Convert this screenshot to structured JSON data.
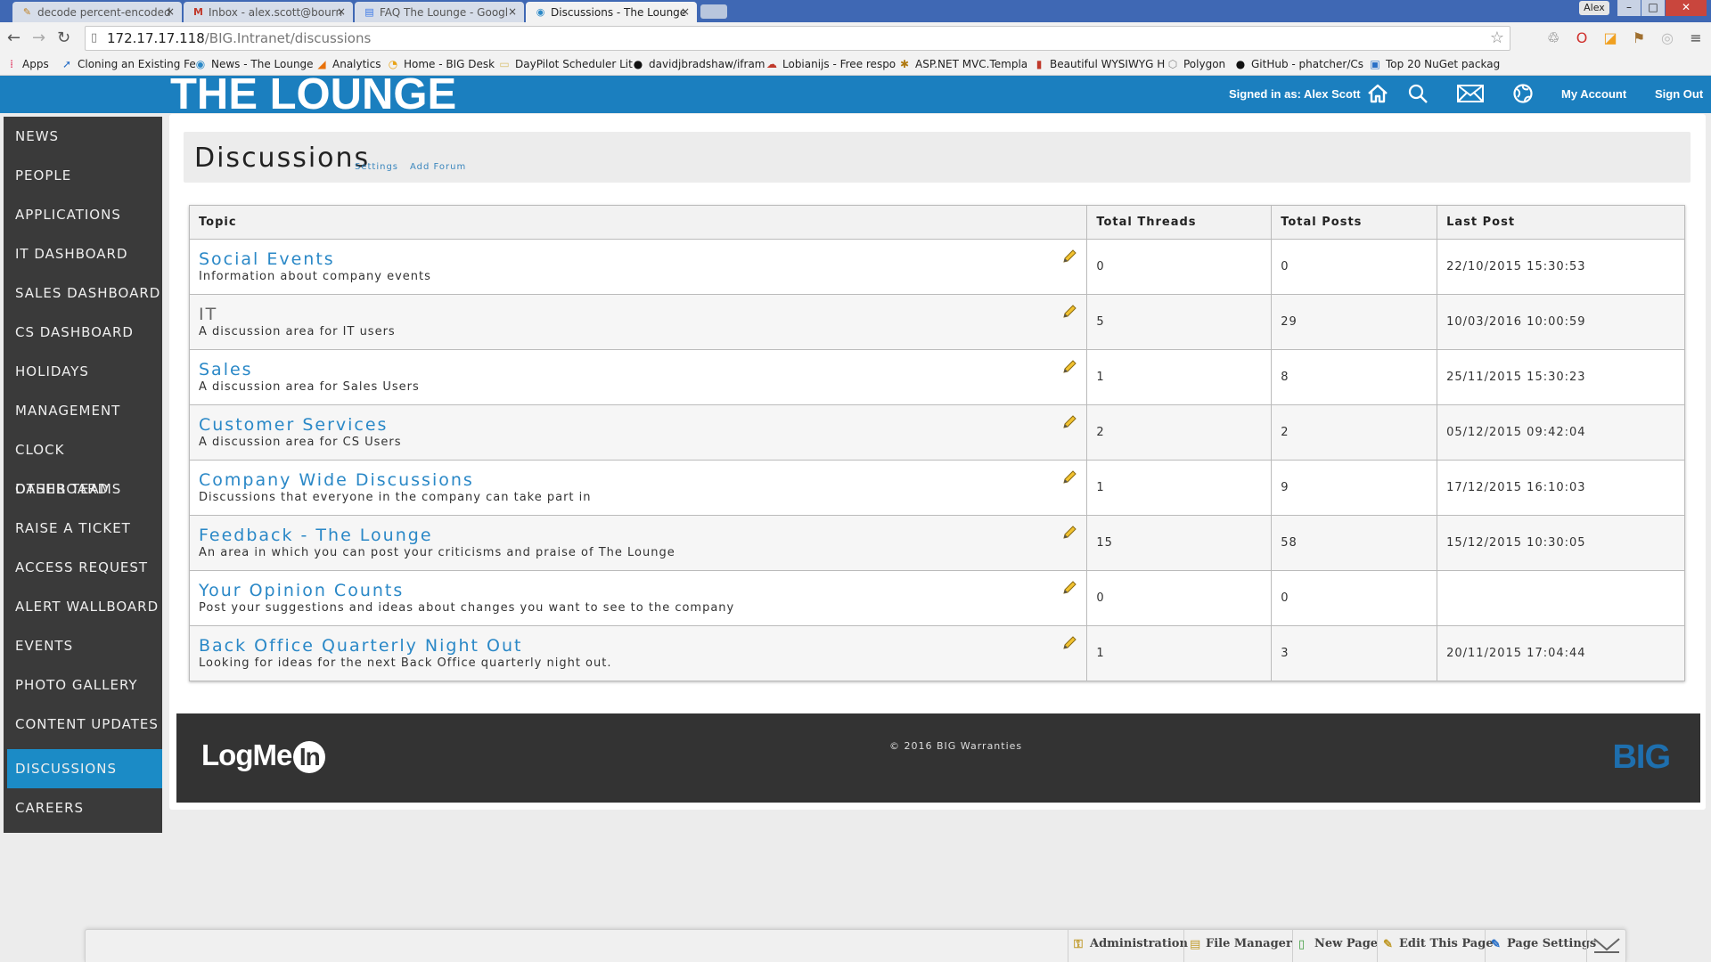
{
  "browser": {
    "tabs": [
      {
        "label": "decode percent-encoded",
        "icon": "tool-icon"
      },
      {
        "label": "Inbox - alex.scott@bourn",
        "icon": "gmail-icon"
      },
      {
        "label": "FAQ The Lounge - Googl",
        "icon": "docs-icon"
      },
      {
        "label": "Discussions - The Lounge",
        "icon": "lounge-icon",
        "active": true
      }
    ],
    "window_user": "Alex",
    "url_host": "172.17.17.118",
    "url_path": "/BIG.Intranet/discussions",
    "bookmarks": [
      {
        "label": "Apps",
        "icon": "apps-icon"
      },
      {
        "label": "Cloning an Existing Fe",
        "icon": "bookmark-icon"
      },
      {
        "label": "News - The Lounge",
        "icon": "lounge-icon"
      },
      {
        "label": "Analytics",
        "icon": "analytics-icon"
      },
      {
        "label": "Home - BIG Desk",
        "icon": "home-icon"
      },
      {
        "label": "DayPilot Scheduler Lit",
        "icon": "folder-icon"
      },
      {
        "label": "davidjbradshaw/ifram",
        "icon": "github-icon"
      },
      {
        "label": "Lobianijs - Free respo",
        "icon": "bookmark-icon"
      },
      {
        "label": "ASP.NET MVC.Templa",
        "icon": "bookmark-icon"
      },
      {
        "label": "Beautiful WYSIWYG H",
        "icon": "bookmark-icon"
      },
      {
        "label": "Polygon",
        "icon": "polygon-icon"
      },
      {
        "label": "GitHub - phatcher/Cs",
        "icon": "github-icon"
      },
      {
        "label": "Top 20 NuGet packag",
        "icon": "nuget-icon"
      }
    ]
  },
  "header": {
    "brand": "THE LOUNGE",
    "signed_in": "Signed in as: Alex Scott",
    "my_account": "My Account",
    "sign_out": "Sign Out"
  },
  "sidebar": {
    "items": [
      {
        "label": "NEWS",
        "slug": "news"
      },
      {
        "label": "PEOPLE",
        "slug": "people"
      },
      {
        "label": "APPLICATIONS",
        "slug": "applications"
      },
      {
        "label": "IT DASHBOARD",
        "slug": "it-dashboard"
      },
      {
        "label": "SALES DASHBOARD",
        "slug": "sales-dashboard"
      },
      {
        "label": "CS DASHBOARD",
        "slug": "cs-dashboard"
      },
      {
        "label": "HOLIDAYS",
        "slug": "holidays"
      },
      {
        "label": "MANAGEMENT",
        "slug": "management"
      },
      {
        "label": "CLOCK DASHBOARD",
        "slug": "clock-dashboard"
      },
      {
        "label": "OTHER TEAMS",
        "slug": "other-teams"
      },
      {
        "label": "RAISE A TICKET",
        "slug": "raise-a-ticket"
      },
      {
        "label": "ACCESS REQUEST",
        "slug": "access-request"
      },
      {
        "label": "ALERT WALLBOARD",
        "slug": "alert-wallboard"
      },
      {
        "label": "EVENTS",
        "slug": "events"
      },
      {
        "label": "PHOTO GALLERY",
        "slug": "photo-gallery"
      },
      {
        "label": "CONTENT UPDATES",
        "slug": "content-updates"
      },
      {
        "label": "DISCUSSIONS",
        "slug": "discussions",
        "active": true
      },
      {
        "label": "CAREERS",
        "slug": "careers"
      }
    ]
  },
  "page": {
    "title": "Discussions",
    "settings_link": "Settings",
    "add_forum_link": "Add Forum"
  },
  "table": {
    "headers": {
      "topic": "Topic",
      "threads": "Total Threads",
      "posts": "Total Posts",
      "last": "Last Post"
    },
    "rows": [
      {
        "name": "Social Events",
        "desc": "Information about company events",
        "threads": "0",
        "posts": "0",
        "last": "22/10/2015 15:30:53"
      },
      {
        "name": "IT",
        "desc": "A discussion area for IT users",
        "threads": "5",
        "posts": "29",
        "last": "10/03/2016 10:00:59",
        "muted": true
      },
      {
        "name": "Sales",
        "desc": "A discussion area for Sales Users",
        "threads": "1",
        "posts": "8",
        "last": "25/11/2015 15:30:23"
      },
      {
        "name": "Customer Services",
        "desc": "A discussion area for CS Users",
        "threads": "2",
        "posts": "2",
        "last": "05/12/2015 09:42:04"
      },
      {
        "name": "Company Wide Discussions",
        "desc": "Discussions that everyone in the company can take part in",
        "threads": "1",
        "posts": "9",
        "last": "17/12/2015 16:10:03"
      },
      {
        "name": "Feedback - The Lounge",
        "desc": "An area in which you can post your criticisms and praise of The Lounge",
        "threads": "15",
        "posts": "58",
        "last": "15/12/2015 10:30:05"
      },
      {
        "name": "Your Opinion Counts",
        "desc": "Post your suggestions and ideas about changes you want to see to the company",
        "threads": "0",
        "posts": "0",
        "last": ""
      },
      {
        "name": "Back Office Quarterly Night Out",
        "desc": "Looking for ideas for the next Back Office quarterly night out.",
        "threads": "1",
        "posts": "3",
        "last": "20/11/2015 17:04:44"
      }
    ]
  },
  "footer": {
    "logmein_text": "LogMe",
    "logmein_in": "In",
    "copyright": "© 2016 BIG Warranties",
    "big_logo": "BIG"
  },
  "adminbar": {
    "administration": "Administration",
    "file_manager": "File Manager",
    "new_page": "New Page",
    "edit_this_page": "Edit This Page",
    "page_settings": "Page Settings"
  },
  "colors": {
    "header_blue": "#1b7fbf",
    "sidebar_dark": "#3a3a3a",
    "sidebar_active": "#1b8bc6",
    "link_blue": "#2a88c7",
    "footer_dark": "#333333"
  }
}
